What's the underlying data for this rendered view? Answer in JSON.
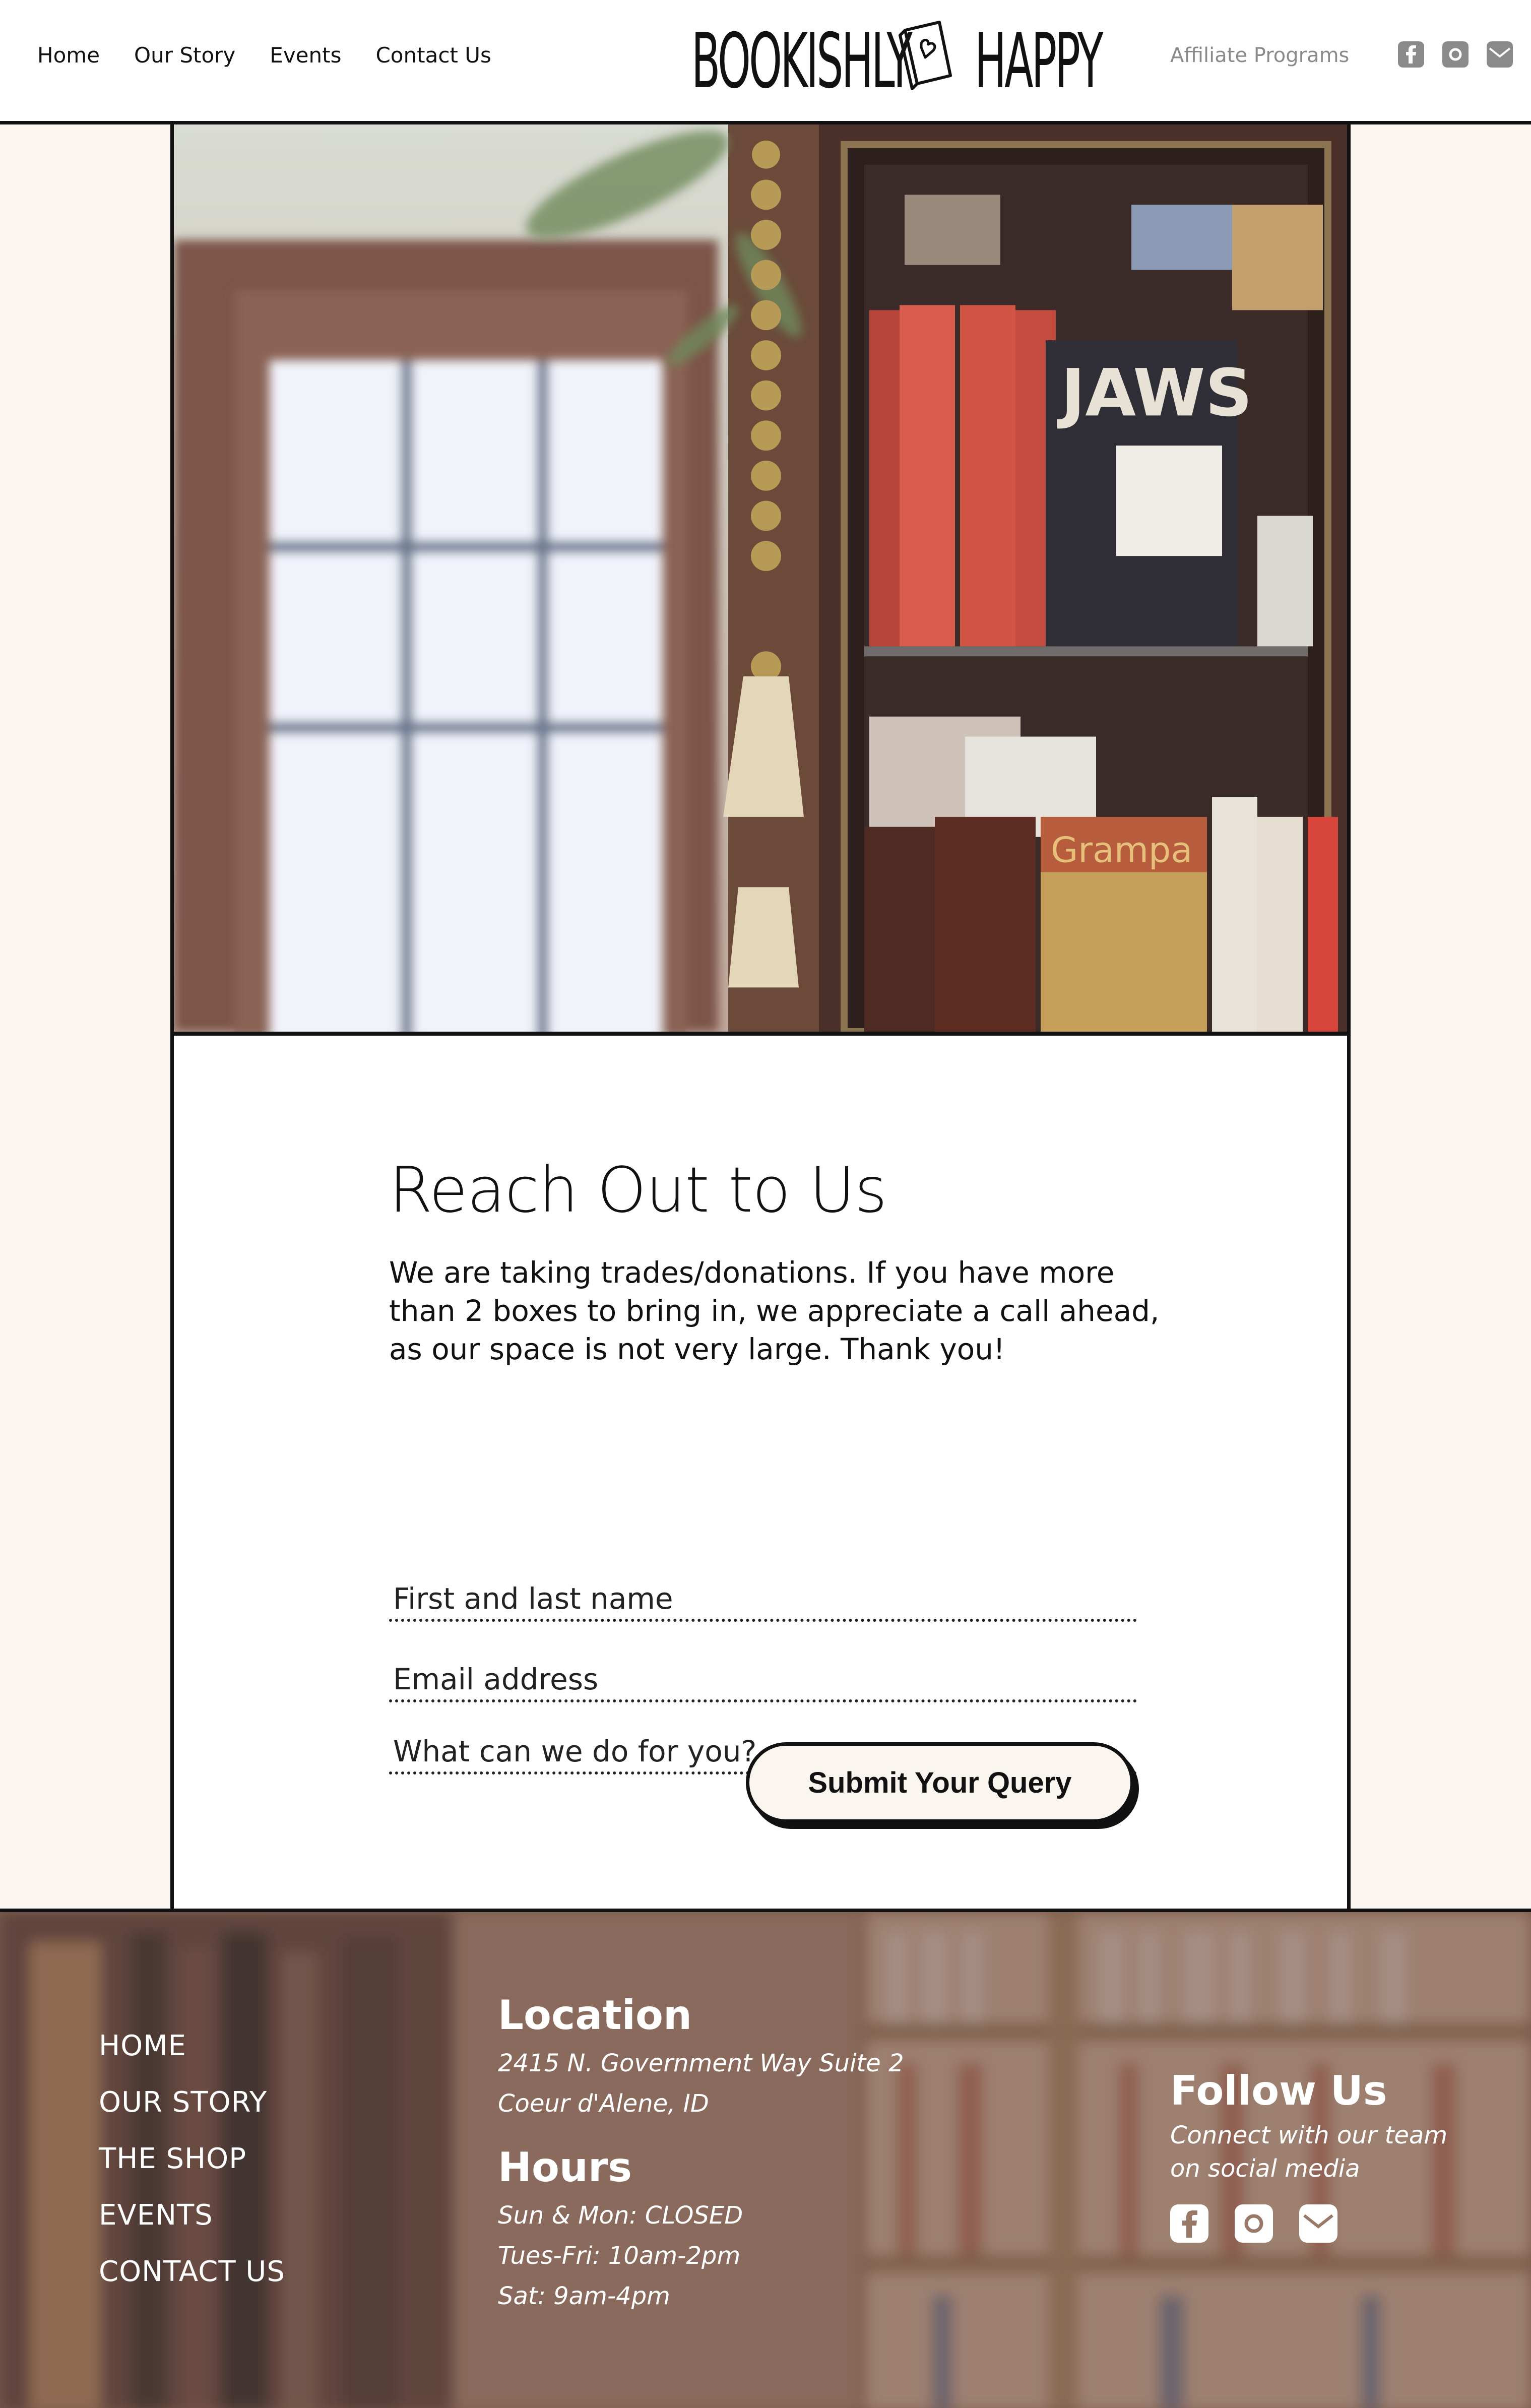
{
  "header": {
    "nav": [
      "Home",
      "Our Story",
      "Events",
      "Contact Us"
    ],
    "logo_left": "BOOKISHLY",
    "logo_right": "HAPPY",
    "affiliate": "Affiliate Programs",
    "social_icons": [
      "facebook-icon",
      "instagram-icon",
      "email-icon"
    ]
  },
  "main": {
    "title": "Reach Out to Us",
    "body": "We are taking trades/donations. If you have more than 2 boxes to bring in, we appreciate a call ahead, as our space is not very large. Thank you!",
    "form": {
      "name_placeholder": "First and last name",
      "email_placeholder": "Email address",
      "message_placeholder": "What can we do for you?",
      "submit_label": "Submit Your Query"
    }
  },
  "footer": {
    "nav": [
      "HOME",
      "OUR STORY",
      "THE SHOP",
      "EVENTS",
      "CONTACT US"
    ],
    "location_heading": "Location",
    "address_line1": "2415 N. Government Way Suite 2",
    "address_line2": "Coeur d'Alene, ID",
    "hours_heading": "Hours",
    "hours": [
      "Sun & Mon: CLOSED",
      "Tues-Fri: 10am-2pm",
      "Sat: 9am-4pm"
    ],
    "follow_heading": "Follow Us",
    "follow_sub_1": "Connect with our team",
    "follow_sub_2": "on social media"
  },
  "colors": {
    "page_bg": "#faf6ef",
    "ink": "#111111",
    "muted": "#8a8a8a"
  }
}
